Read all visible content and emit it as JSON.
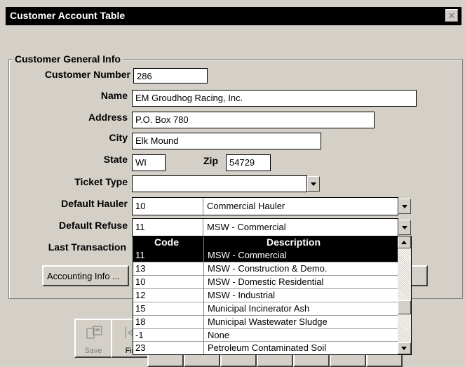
{
  "window": {
    "title": "Customer Account Table"
  },
  "group": {
    "legend": "Customer General Info"
  },
  "labels": {
    "customer_number": "Customer Number",
    "name": "Name",
    "address": "Address",
    "city": "City",
    "state": "State",
    "zip": "Zip",
    "ticket_type": "Ticket Type",
    "default_hauler": "Default Hauler",
    "default_refuse": "Default Refuse",
    "last_transaction": "Last Transaction"
  },
  "fields": {
    "customer_number": "286",
    "name": "EM Groudhog Racing, Inc.",
    "address": "P.O. Box 780",
    "city": "Elk Mound",
    "state": "WI",
    "zip": "54729",
    "ticket_type": ""
  },
  "hauler": {
    "code": "10",
    "description": "Commercial Hauler"
  },
  "refuse": {
    "code": "11",
    "description": "MSW - Commercial"
  },
  "refuse_list": {
    "headers": {
      "code": "Code",
      "description": "Description"
    },
    "rows": [
      {
        "code": "11",
        "description": "MSW - Commercial",
        "selected": true
      },
      {
        "code": "13",
        "description": "MSW - Construction & Demo."
      },
      {
        "code": "10",
        "description": "MSW - Domestic Residential"
      },
      {
        "code": "12",
        "description": "MSW - Industrial"
      },
      {
        "code": "15",
        "description": "Municipal Incinerator Ash"
      },
      {
        "code": "18",
        "description": "Municipal Wastewater Sludge"
      },
      {
        "code": "-1",
        "description": "None"
      },
      {
        "code": "23",
        "description": "Petroleum Contaminated Soil"
      }
    ]
  },
  "buttons": {
    "accounting_info": "Accounting Info ..."
  },
  "toolbar": {
    "save": "Save",
    "first": "Fir"
  },
  "colors": {
    "face": "#d4d0c8",
    "titlebar": "#000000",
    "selection": "#000000"
  }
}
